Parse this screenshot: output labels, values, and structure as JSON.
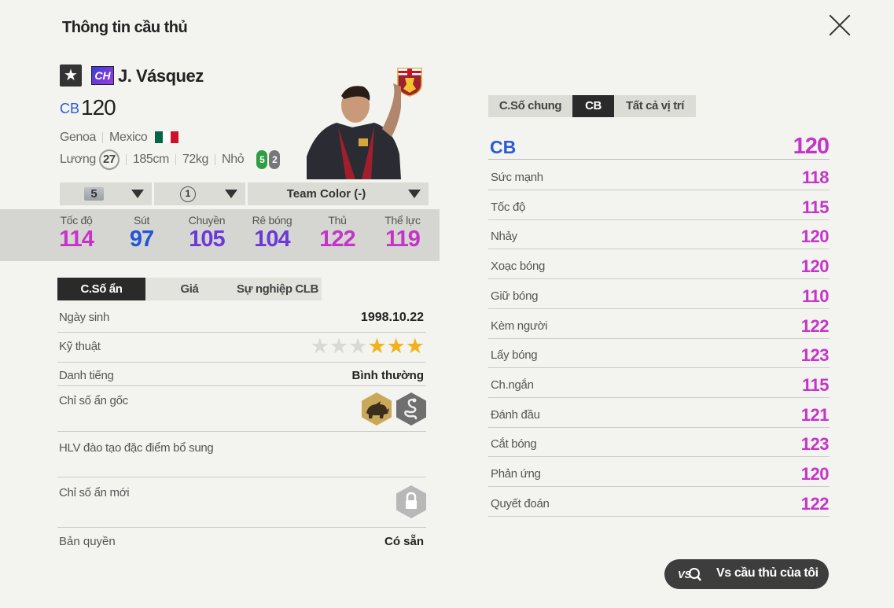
{
  "header": {
    "title": "Thông tin cầu thủ"
  },
  "player": {
    "season_badge": "CH",
    "name": "J. Vásquez",
    "position": "CB",
    "ovr": "120",
    "club": "Genoa",
    "nation": "Mexico",
    "salary_label": "Lương",
    "salary": "27",
    "height": "185cm",
    "weight": "72kg",
    "body_type": "Nhỏ",
    "weak_foot_left": "5",
    "weak_foot_right": "2"
  },
  "selectors": {
    "upgrade_level": "5",
    "team_color_rank": "1",
    "team_color": "Team Color (-)"
  },
  "main_stats": [
    {
      "label": "Tốc độ",
      "value": "114",
      "color": "#c534c9"
    },
    {
      "label": "Sút",
      "value": "97",
      "color": "#2255d8"
    },
    {
      "label": "Chuyền",
      "value": "105",
      "color": "#6a3ad8"
    },
    {
      "label": "Rê bóng",
      "value": "104",
      "color": "#6a3ad8"
    },
    {
      "label": "Thủ",
      "value": "122",
      "color": "#c534c9"
    },
    {
      "label": "Thể lực",
      "value": "119",
      "color": "#c534c9"
    }
  ],
  "left_tabs": [
    "C.Số ẩn",
    "Giá",
    "Sự nghiệp CLB"
  ],
  "info": {
    "birth_label": "Ngày sinh",
    "birth": "1998.10.22",
    "skill_label": "Kỹ thuật",
    "skill_stars": 3,
    "fame_label": "Danh tiếng",
    "fame": "Bình thường",
    "hidden_label": "Chỉ số ẩn gốc",
    "coach_label": "HLV đào tạo đặc điểm bổ sung",
    "new_hidden_label": "Chỉ số ẩn mới",
    "license_label": "Bản quyền",
    "license": "Có sẵn"
  },
  "right_tabs": [
    "C.Số chung",
    "CB",
    "Tất cả vị trí"
  ],
  "position_ovr": {
    "position": "CB",
    "value": "120"
  },
  "detail_stats": [
    {
      "label": "Sức mạnh",
      "value": "118"
    },
    {
      "label": "Tốc độ",
      "value": "115"
    },
    {
      "label": "Nhảy",
      "value": "120"
    },
    {
      "label": "Xoạc bóng",
      "value": "120"
    },
    {
      "label": "Giữ bóng",
      "value": "110"
    },
    {
      "label": "Kèm người",
      "value": "122"
    },
    {
      "label": "Lấy bóng",
      "value": "123"
    },
    {
      "label": "Ch.ngắn",
      "value": "115"
    },
    {
      "label": "Đánh đầu",
      "value": "121"
    },
    {
      "label": "Cắt bóng",
      "value": "123"
    },
    {
      "label": "Phản ứng",
      "value": "120"
    },
    {
      "label": "Quyết đoán",
      "value": "122"
    }
  ],
  "compare_button": {
    "icon_text": "VS",
    "label": "Vs cầu thủ của tôi"
  },
  "colors": {
    "accent_purple": "#c534c9",
    "accent_blue": "#2a5ad8",
    "dark": "#2a2a2a"
  },
  "icons": [
    "close-icon",
    "star-icon",
    "genoa-crest-icon",
    "mexico-flag-icon",
    "rhino-trait-icon",
    "snake-trait-icon",
    "lock-icon",
    "vs-search-icon"
  ]
}
